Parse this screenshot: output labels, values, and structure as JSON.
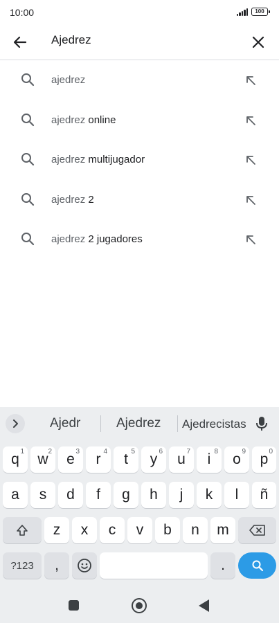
{
  "status_bar": {
    "time": "10:00",
    "battery": "100"
  },
  "search": {
    "query": "Ajedrez",
    "icons": {
      "back": "arrow-left-icon",
      "clear": "close-icon"
    }
  },
  "suggestions": [
    {
      "typed": "ajedrez",
      "rest": ""
    },
    {
      "typed": "ajedrez",
      "rest": " online"
    },
    {
      "typed": "ajedrez",
      "rest": " multijugador"
    },
    {
      "typed": "ajedrez",
      "rest": " 2"
    },
    {
      "typed": "ajedrez",
      "rest": " 2 jugadores"
    }
  ],
  "keyboard": {
    "strip_words": [
      "Ajedr",
      "Ajedrez",
      "Ajedrecistas"
    ],
    "row1": [
      {
        "key": "q",
        "hint": "1"
      },
      {
        "key": "w",
        "hint": "2"
      },
      {
        "key": "e",
        "hint": "3"
      },
      {
        "key": "r",
        "hint": "4"
      },
      {
        "key": "t",
        "hint": "5"
      },
      {
        "key": "y",
        "hint": "6"
      },
      {
        "key": "u",
        "hint": "7"
      },
      {
        "key": "i",
        "hint": "8"
      },
      {
        "key": "o",
        "hint": "9"
      },
      {
        "key": "p",
        "hint": "0"
      }
    ],
    "row2": [
      "a",
      "s",
      "d",
      "f",
      "g",
      "h",
      "j",
      "k",
      "l",
      "ñ"
    ],
    "row3": [
      "z",
      "x",
      "c",
      "v",
      "b",
      "n",
      "m"
    ],
    "symbols_label": "?123",
    "comma": ",",
    "period": "."
  },
  "colors": {
    "accent": "#2c9be6",
    "keyboard_bg": "#eceef0",
    "text": "#202124"
  }
}
